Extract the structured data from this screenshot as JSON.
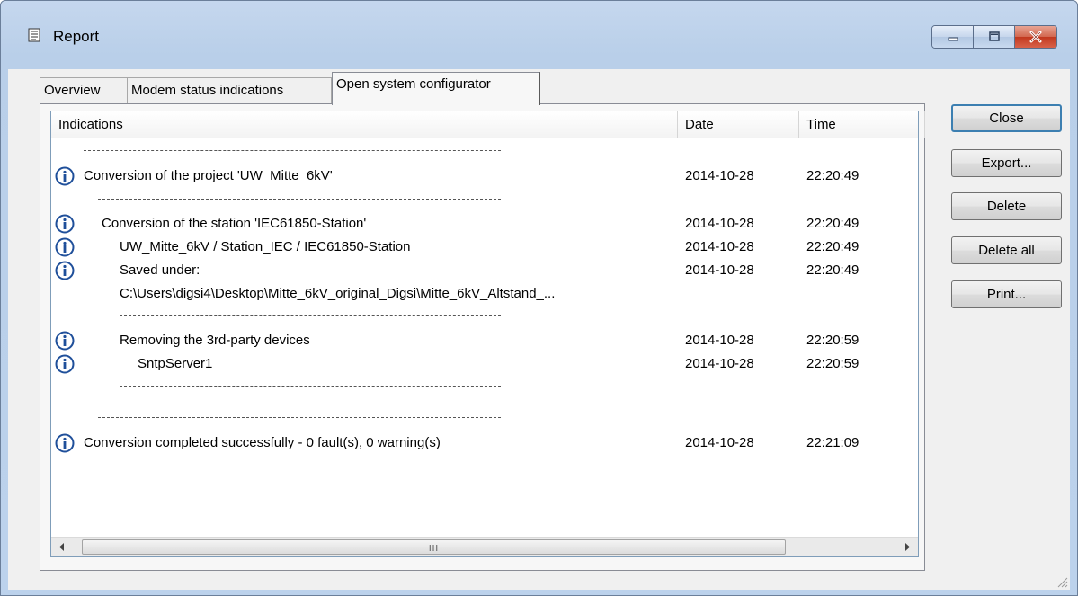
{
  "window": {
    "title": "Report",
    "caption": {
      "minimize": "minimize",
      "maximize": "maximize",
      "close": "close"
    }
  },
  "tabs": [
    {
      "label": "Overview"
    },
    {
      "label": "Modem status indications"
    },
    {
      "label": "Open system configurator"
    }
  ],
  "active_tab": "Open system configurator",
  "columns": {
    "indications": "Indications",
    "date": "Date",
    "time": "Time"
  },
  "rows": [
    {
      "indication": "Conversion of the project 'UW_Mitte_6kV'",
      "date": "2014-10-28",
      "time": "22:20:49",
      "icon": "info-icon"
    },
    {
      "indication": "Conversion of the station 'IEC61850-Station'",
      "date": "2014-10-28",
      "time": "22:20:49",
      "icon": "info-icon"
    },
    {
      "indication": "UW_Mitte_6kV / Station_IEC / IEC61850-Station",
      "date": "2014-10-28",
      "time": "22:20:49",
      "icon": "info-icon"
    },
    {
      "indication": "Saved under:",
      "date": "2014-10-28",
      "time": "22:20:49",
      "icon": "info-icon"
    },
    {
      "indication": "C:\\Users\\digsi4\\Desktop\\Mitte_6kV_original_Digsi\\Mitte_6kV_Altstand_...",
      "date": "",
      "time": ""
    },
    {
      "indication": "Removing the 3rd-party devices",
      "date": "2014-10-28",
      "time": "22:20:59",
      "icon": "info-icon"
    },
    {
      "indication": "SntpServer1",
      "date": "2014-10-28",
      "time": "22:20:59",
      "icon": "info-icon"
    },
    {
      "indication": "Conversion completed successfully - 0 fault(s), 0 warning(s)",
      "date": "2014-10-28",
      "time": "22:21:09",
      "icon": "info-icon"
    }
  ],
  "scrollbar": {
    "grip": "III"
  },
  "buttons": {
    "close": "Close",
    "export": "Export...",
    "delete": "Delete",
    "delete_all": "Delete all",
    "print": "Print..."
  },
  "colors": {
    "accent": "#3c7fb1",
    "info_icon": "#1f4f9a",
    "close_button": "#c1381e"
  }
}
